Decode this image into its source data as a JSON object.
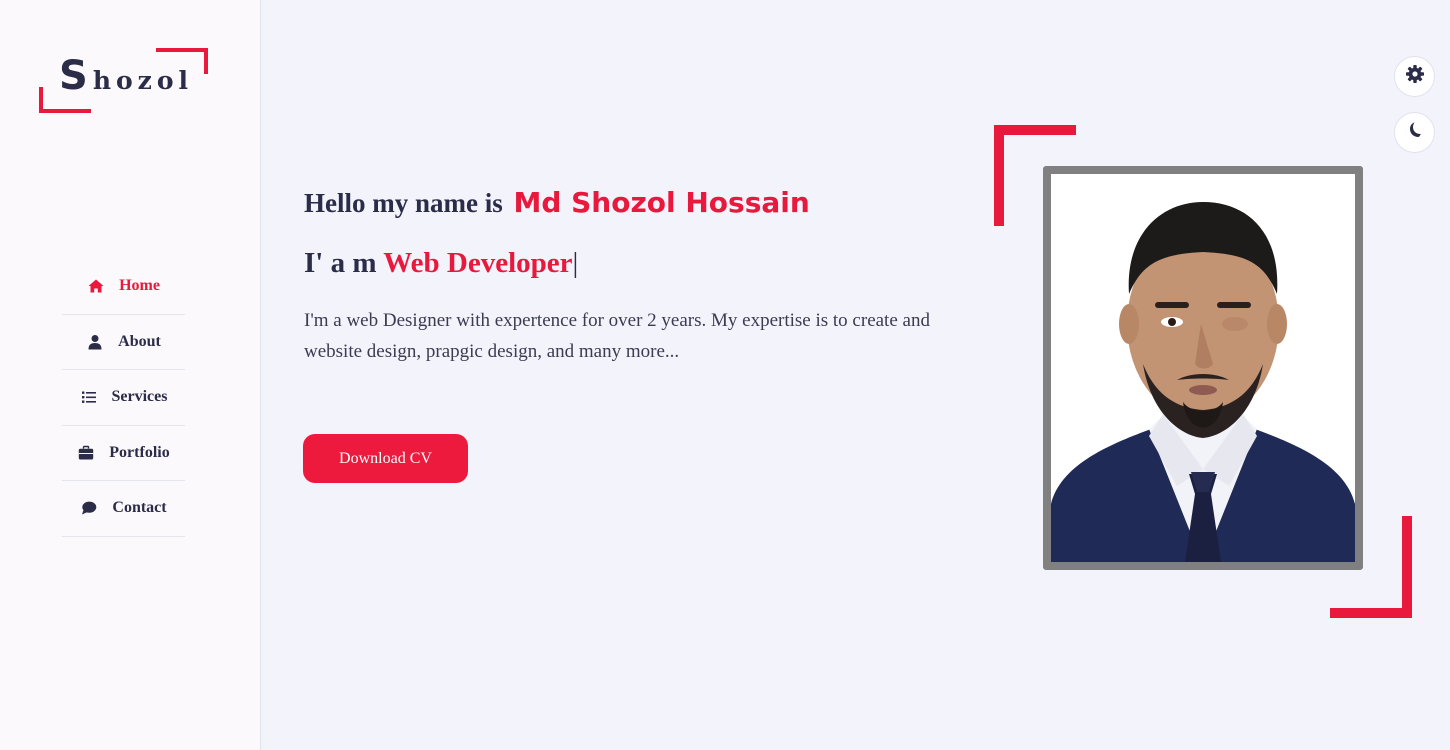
{
  "brand": {
    "logo_first": "S",
    "logo_rest": "hozol"
  },
  "sidebar": {
    "items": [
      {
        "label": "Home",
        "icon": "home-icon",
        "active": true
      },
      {
        "label": "About",
        "icon": "user-icon",
        "active": false
      },
      {
        "label": "Services",
        "icon": "list-icon",
        "active": false
      },
      {
        "label": "Portfolio",
        "icon": "briefcase-icon",
        "active": false
      },
      {
        "label": "Contact",
        "icon": "chat-icon",
        "active": false
      }
    ]
  },
  "hero": {
    "greeting": "Hello my name is",
    "name": "Md Shozol Hossain",
    "role_prefix": "I' a m",
    "role": "Web Developer",
    "cursor": "|",
    "description": "I'm a web Designer with expertence for over 2 years. My expertise is to create and website design, prapgic design, and many more...",
    "cta_label": "Download CV"
  },
  "controls": {
    "settings_icon": "gear-icon",
    "theme_icon": "moon-icon"
  },
  "colors": {
    "accent": "#e8193c",
    "text": "#2b2c48",
    "background": "#f2f3fb",
    "sidebar": "#fcf9fd"
  }
}
